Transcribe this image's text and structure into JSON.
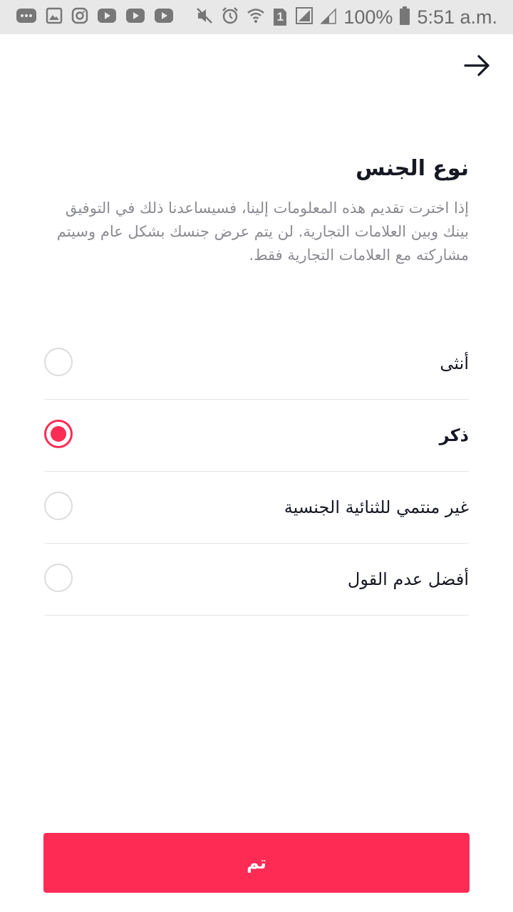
{
  "status_bar": {
    "battery_text": "100%",
    "time": "5:51 a.m.",
    "sim_slot": "1",
    "icons_left": [
      "more-icon",
      "gallery-icon",
      "instagram-icon",
      "youtube-icon",
      "youtube-icon",
      "youtube-icon"
    ],
    "icons_right": [
      "mute-icon",
      "alarm-icon",
      "wifi-icon",
      "sim-icon",
      "signal-icon",
      "signal-icon",
      "battery-icon"
    ]
  },
  "header": {
    "back_icon": "arrow-right-icon"
  },
  "page": {
    "title": "نوع الجنس",
    "description": "إذا اخترت تقديم هذه المعلومات إلينا، فسيساعدنا ذلك في التوفيق بينك وبين العلامات التجارية. لن يتم عرض جنسك بشكل عام وسيتم مشاركته مع العلامات التجارية فقط."
  },
  "options": [
    {
      "label": "أنثى",
      "selected": false
    },
    {
      "label": "ذكر",
      "selected": true
    },
    {
      "label": "غير منتمي للثنائية الجنسية",
      "selected": false
    },
    {
      "label": "أفضل عدم القول",
      "selected": false
    }
  ],
  "done_button": {
    "label": "تم"
  },
  "colors": {
    "accent": "#fe2c55",
    "title_text": "#161823",
    "secondary_text": "#8a8b91",
    "divider": "#e6e6e8",
    "status_bar_bg": "#e8e8e8"
  }
}
